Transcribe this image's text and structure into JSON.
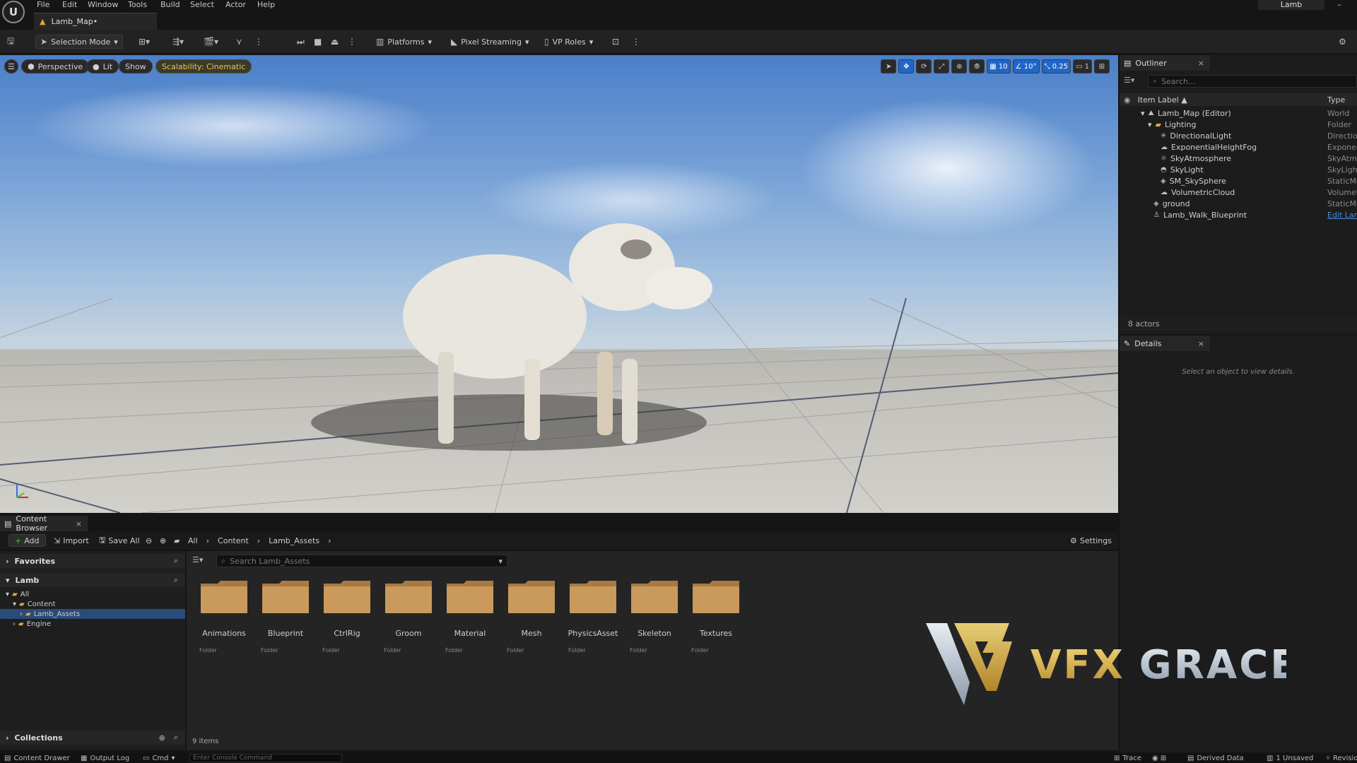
{
  "menu": [
    "File",
    "Edit",
    "Window",
    "Tools",
    "Build",
    "Select",
    "Actor",
    "Help"
  ],
  "logo": "U",
  "doc_tab": "Lamb_Map•",
  "project": "Lamb",
  "minimize": "–",
  "toolbar": {
    "selection_mode": "Selection Mode",
    "platforms": "Platforms",
    "pixel_streaming": "Pixel Streaming",
    "vp_roles": "VP Roles"
  },
  "viewport": {
    "perspective": "Perspective",
    "lit": "Lit",
    "show": "Show",
    "scalability": "Scalability: Cinematic",
    "grid_snap": "10",
    "rot_snap": "10°",
    "scale_snap": "0.25",
    "camera_speed": "1"
  },
  "outliner": {
    "title": "Outliner",
    "search_placeholder": "Search...",
    "col_label": "Item Label ▲",
    "col_type": "Type",
    "rows": [
      {
        "label": "Lamb_Map (Editor)",
        "type": "World"
      },
      {
        "label": "Lighting",
        "type": "Folder"
      },
      {
        "label": "DirectionalLight",
        "type": "DirectionalLight"
      },
      {
        "label": "ExponentialHeightFog",
        "type": "ExponentialHeightFog"
      },
      {
        "label": "SkyAtmosphere",
        "type": "SkyAtmosphere"
      },
      {
        "label": "SkyLight",
        "type": "SkyLight"
      },
      {
        "label": "SM_SkySphere",
        "type": "StaticMeshActor"
      },
      {
        "label": "VolumetricCloud",
        "type": "VolumetricCloud"
      },
      {
        "label": "ground",
        "type": "StaticMeshActor"
      },
      {
        "label": "Lamb_Walk_Blueprint",
        "type": "Edit Lamb"
      }
    ],
    "actors_count": "8 actors"
  },
  "details": {
    "title": "Details",
    "empty_message": "Select an object to view details."
  },
  "content_browser": {
    "title": "Content Browser",
    "add": "Add",
    "import": "Import",
    "save_all": "Save All",
    "breadcrumb": [
      "All",
      "Content",
      "Lamb_Assets"
    ],
    "settings": "Settings",
    "favorites": "Favorites",
    "project": "Lamb",
    "tree": [
      {
        "label": "All"
      },
      {
        "label": "Content"
      },
      {
        "label": "Lamb_Assets"
      },
      {
        "label": "Engine"
      }
    ],
    "collections": "Collections",
    "search_placeholder": "Search Lamb_Assets",
    "folders": [
      {
        "name": "Animations",
        "type": "Folder"
      },
      {
        "name": "Blueprint",
        "type": "Folder"
      },
      {
        "name": "CtrlRig",
        "type": "Folder"
      },
      {
        "name": "Groom",
        "type": "Folder"
      },
      {
        "name": "Material",
        "type": "Folder"
      },
      {
        "name": "Mesh",
        "type": "Folder"
      },
      {
        "name": "PhysicsAsset",
        "type": "Folder"
      },
      {
        "name": "Skeleton",
        "type": "Folder"
      },
      {
        "name": "Textures",
        "type": "Folder"
      }
    ],
    "items_count": "9 items"
  },
  "watermark": {
    "text": "VFX GRACE"
  },
  "statusbar": {
    "content_drawer": "Content Drawer",
    "output_log": "Output Log",
    "cmd": "Cmd",
    "console_placeholder": "Enter Console Command",
    "trace": "Trace",
    "derived_data": "Derived Data",
    "unsaved": "1 Unsaved",
    "revision": "Revision"
  },
  "colors": {
    "accent": "#1f66c9",
    "folder": "#c99a5b",
    "scalability": "#e3c45a"
  }
}
